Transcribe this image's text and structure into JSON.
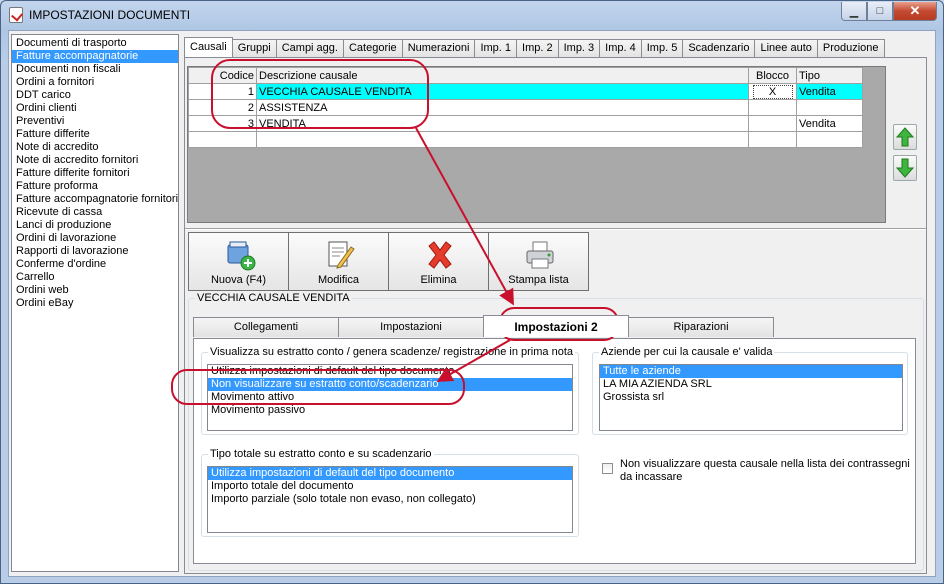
{
  "window": {
    "title": "IMPOSTAZIONI DOCUMENTI",
    "min_glyph": "▁",
    "max_glyph": "□",
    "close_glyph": "✕"
  },
  "doc_types": [
    "Documenti di trasporto",
    "Fatture accompagnatorie",
    "Documenti non fiscali",
    "Ordini a fornitori",
    "DDT carico",
    "Ordini clienti",
    "Preventivi",
    "Fatture differite",
    "Note di accredito",
    "Note di accredito fornitori",
    "Fatture differite fornitori",
    "Fatture proforma",
    "Fatture accompagnatorie fornitori",
    "Ricevute di cassa",
    "Lanci di produzione",
    "Ordini di lavorazione",
    "Rapporti di lavorazione",
    "Conferme d'ordine",
    "Carrello",
    "Ordini web",
    "Ordini eBay"
  ],
  "tabs": [
    "Causali",
    "Gruppi",
    "Campi agg.",
    "Categorie",
    "Numerazioni",
    "Imp. 1",
    "Imp. 2",
    "Imp. 3",
    "Imp. 4",
    "Imp. 5",
    "Scadenzario",
    "Linee auto",
    "Produzione"
  ],
  "grid": {
    "headers": {
      "codice": "Codice",
      "descrizione": "Descrizione causale",
      "blocco": "Blocco",
      "tipo": "Tipo"
    },
    "rows": [
      {
        "codice": "1",
        "descrizione": "VECCHIA CAUSALE VENDITA",
        "blocco": "X",
        "tipo": "Vendita"
      },
      {
        "codice": "2",
        "descrizione": "ASSISTENZA",
        "blocco": "",
        "tipo": ""
      },
      {
        "codice": "3",
        "descrizione": "VENDITA",
        "blocco": "",
        "tipo": "Vendita"
      }
    ]
  },
  "toolbar": {
    "nuova": "Nuova (F4)",
    "modifica": "Modifica",
    "elimina": "Elimina",
    "stampa": "Stampa lista"
  },
  "detail": {
    "title": "VECCHIA CAUSALE VENDITA",
    "subtabs": [
      "Collegamenti",
      "Impostazioni",
      "Impostazioni 2",
      "Riparazioni"
    ],
    "estratto": {
      "title": "Visualizza su estratto conto / genera scadenze/ registrazione  in prima nota",
      "options": [
        "Utilizza impostazioni di default del tipo documento",
        "Non visualizzare su estratto conto/scadenzario",
        "Movimento attivo",
        "Movimento passivo"
      ]
    },
    "aziende": {
      "title": "Aziende per cui la causale e' valida",
      "options": [
        "Tutte le aziende",
        "LA MIA AZIENDA SRL",
        "Grossista srl"
      ]
    },
    "tipo_totale": {
      "title": "Tipo totale su estratto conto e su scadenzario",
      "options": [
        "Utilizza impostazioni di default del tipo documento",
        "Importo totale del documento",
        "Importo parziale (solo totale non evaso, non collegato)"
      ]
    },
    "contrassegni_label": "Non visualizzare questa causale nella lista dei contrassegni da incassare"
  },
  "colors": {
    "selection": "#3399ff",
    "row_highlight": "#00ffff",
    "annotation": "#c8102e"
  }
}
